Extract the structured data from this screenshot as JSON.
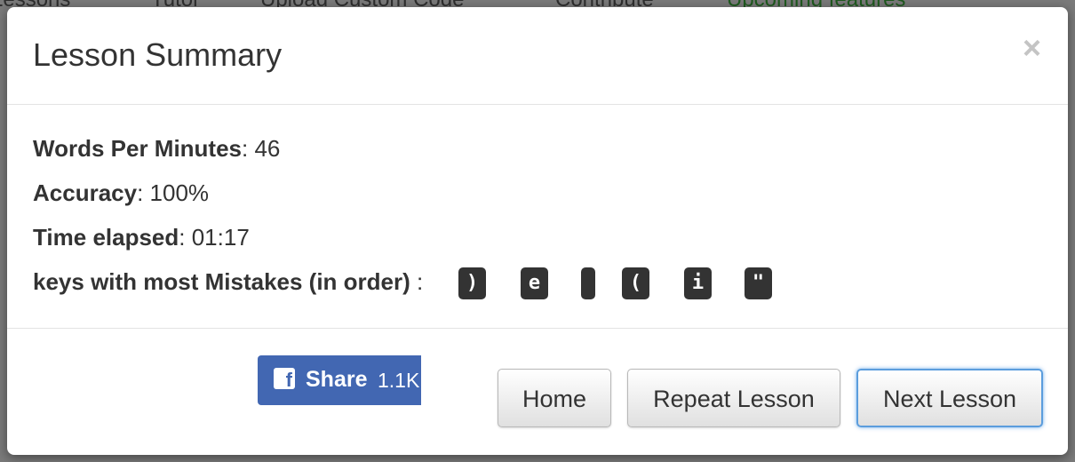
{
  "background_nav": [
    "Lessons",
    "Tutor",
    "Upload Custom Code",
    "Contribute",
    "Upcoming features"
  ],
  "modal": {
    "title": "Lesson Summary",
    "close_symbol": "×"
  },
  "stats": {
    "wpm_label": "Words Per Minutes",
    "wpm_value": ": 46",
    "accuracy_label": "Accuracy",
    "accuracy_value": ": 100%",
    "time_label": "Time elapsed",
    "time_value": ": 01:17",
    "mistakes_label": "keys with most Mistakes (in order)",
    "mistakes_sep": " :",
    "mistake_keys": [
      ")",
      "e",
      "",
      "(",
      "i",
      "\""
    ]
  },
  "share": {
    "label": "Share",
    "count": "1.1K",
    "icon": "facebook-icon"
  },
  "buttons": {
    "home": "Home",
    "repeat": "Repeat Lesson",
    "next": "Next Lesson"
  },
  "colors": {
    "facebook_blue": "#4267b2",
    "kbd_background": "#333333",
    "focus_ring": "#5b9ddd"
  }
}
